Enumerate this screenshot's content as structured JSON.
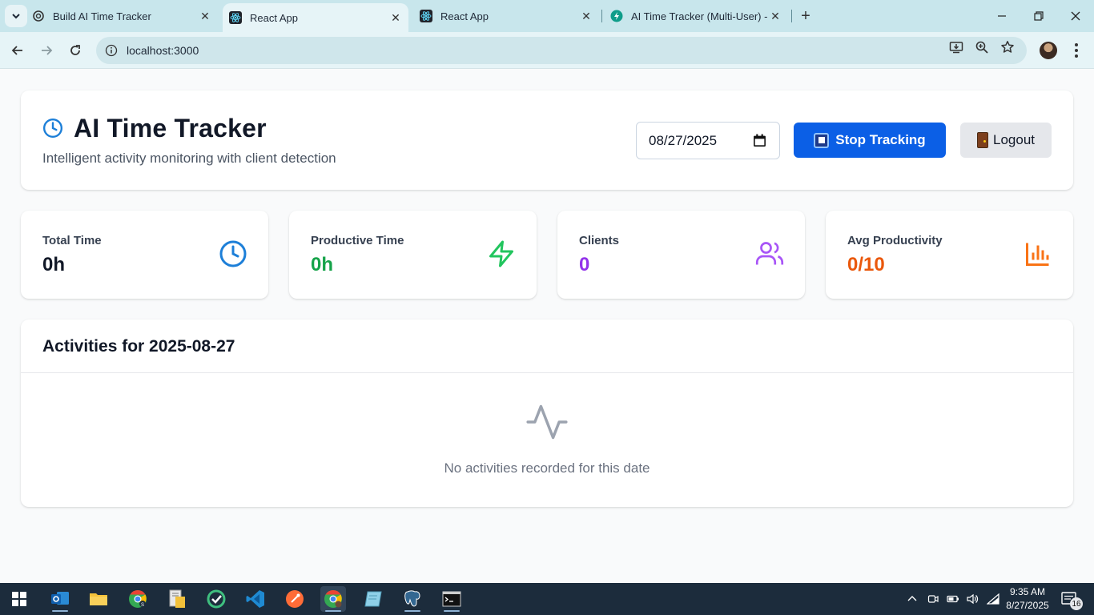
{
  "browser": {
    "tabs": [
      {
        "title": "Build AI Time Tracker",
        "favicon": "openai-icon",
        "active": false
      },
      {
        "title": "React App",
        "favicon": "react-icon",
        "active": true
      },
      {
        "title": "React App",
        "favicon": "react-icon",
        "active": false
      },
      {
        "title": "AI Time Tracker (Multi-User) - S",
        "favicon": "supabase-icon",
        "active": false
      }
    ],
    "url": "localhost:3000"
  },
  "header": {
    "title": "AI Time Tracker",
    "subtitle": "Intelligent activity monitoring with client detection",
    "date_value": "08/27/2025",
    "stop_label": "Stop Tracking",
    "logout_label": "Logout"
  },
  "stats": [
    {
      "label": "Total Time",
      "value": "0h",
      "color": "#111827",
      "icon": "clock-icon",
      "icon_color": "#1d7fd8"
    },
    {
      "label": "Productive Time",
      "value": "0h",
      "color": "#16a34a",
      "icon": "zap-icon",
      "icon_color": "#22c55e"
    },
    {
      "label": "Clients",
      "value": "0",
      "color": "#9333ea",
      "icon": "users-icon",
      "icon_color": "#a855f7"
    },
    {
      "label": "Avg Productivity",
      "value": "0/10",
      "color": "#ea580c",
      "icon": "bar-chart-icon",
      "icon_color": "#f97316"
    }
  ],
  "activities": {
    "title": "Activities for 2025-08-27",
    "empty_text": "No activities recorded for this date"
  },
  "taskbar": {
    "time": "9:35 AM",
    "date": "8/27/2025",
    "notifications": "16"
  },
  "colors": {
    "primary": "#0b5fe6",
    "accent_title_icon": "#1d7fd8"
  }
}
